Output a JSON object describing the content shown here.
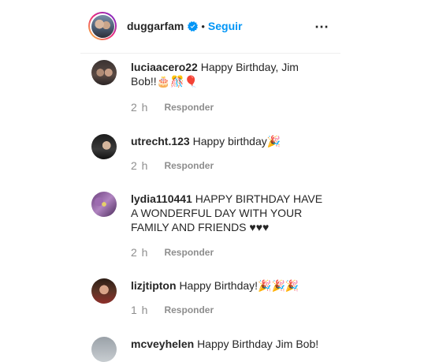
{
  "header": {
    "username": "duggarfam",
    "separator": "•",
    "follow_label": "Seguir",
    "more_icon": "⋯"
  },
  "comments": [
    {
      "user": "luciaacero22",
      "text": "Happy Birthday, Jim Bob!!🎂🎊🎈",
      "time": "2 h",
      "reply": "Responder"
    },
    {
      "user": "utrecht.123",
      "text": "Happy birthday🎉",
      "time": "2 h",
      "reply": "Responder"
    },
    {
      "user": "lydia110441",
      "text": "HAPPY BIRTHDAY HAVE A WONDERFUL DAY WITH YOUR FAMILY AND FRIENDS ♥♥♥",
      "time": "2 h",
      "reply": "Responder"
    },
    {
      "user": "lizjtipton",
      "text": "Happy Birthday!🎉🎉🎉",
      "time": "1 h",
      "reply": "Responder"
    },
    {
      "user": "mcveyhelen",
      "text": "Happy Birthday Jim Bob!",
      "time": "",
      "reply": ""
    }
  ],
  "colors": {
    "accent": "#0095f6",
    "muted": "#8e8e8e",
    "text": "#262626"
  }
}
